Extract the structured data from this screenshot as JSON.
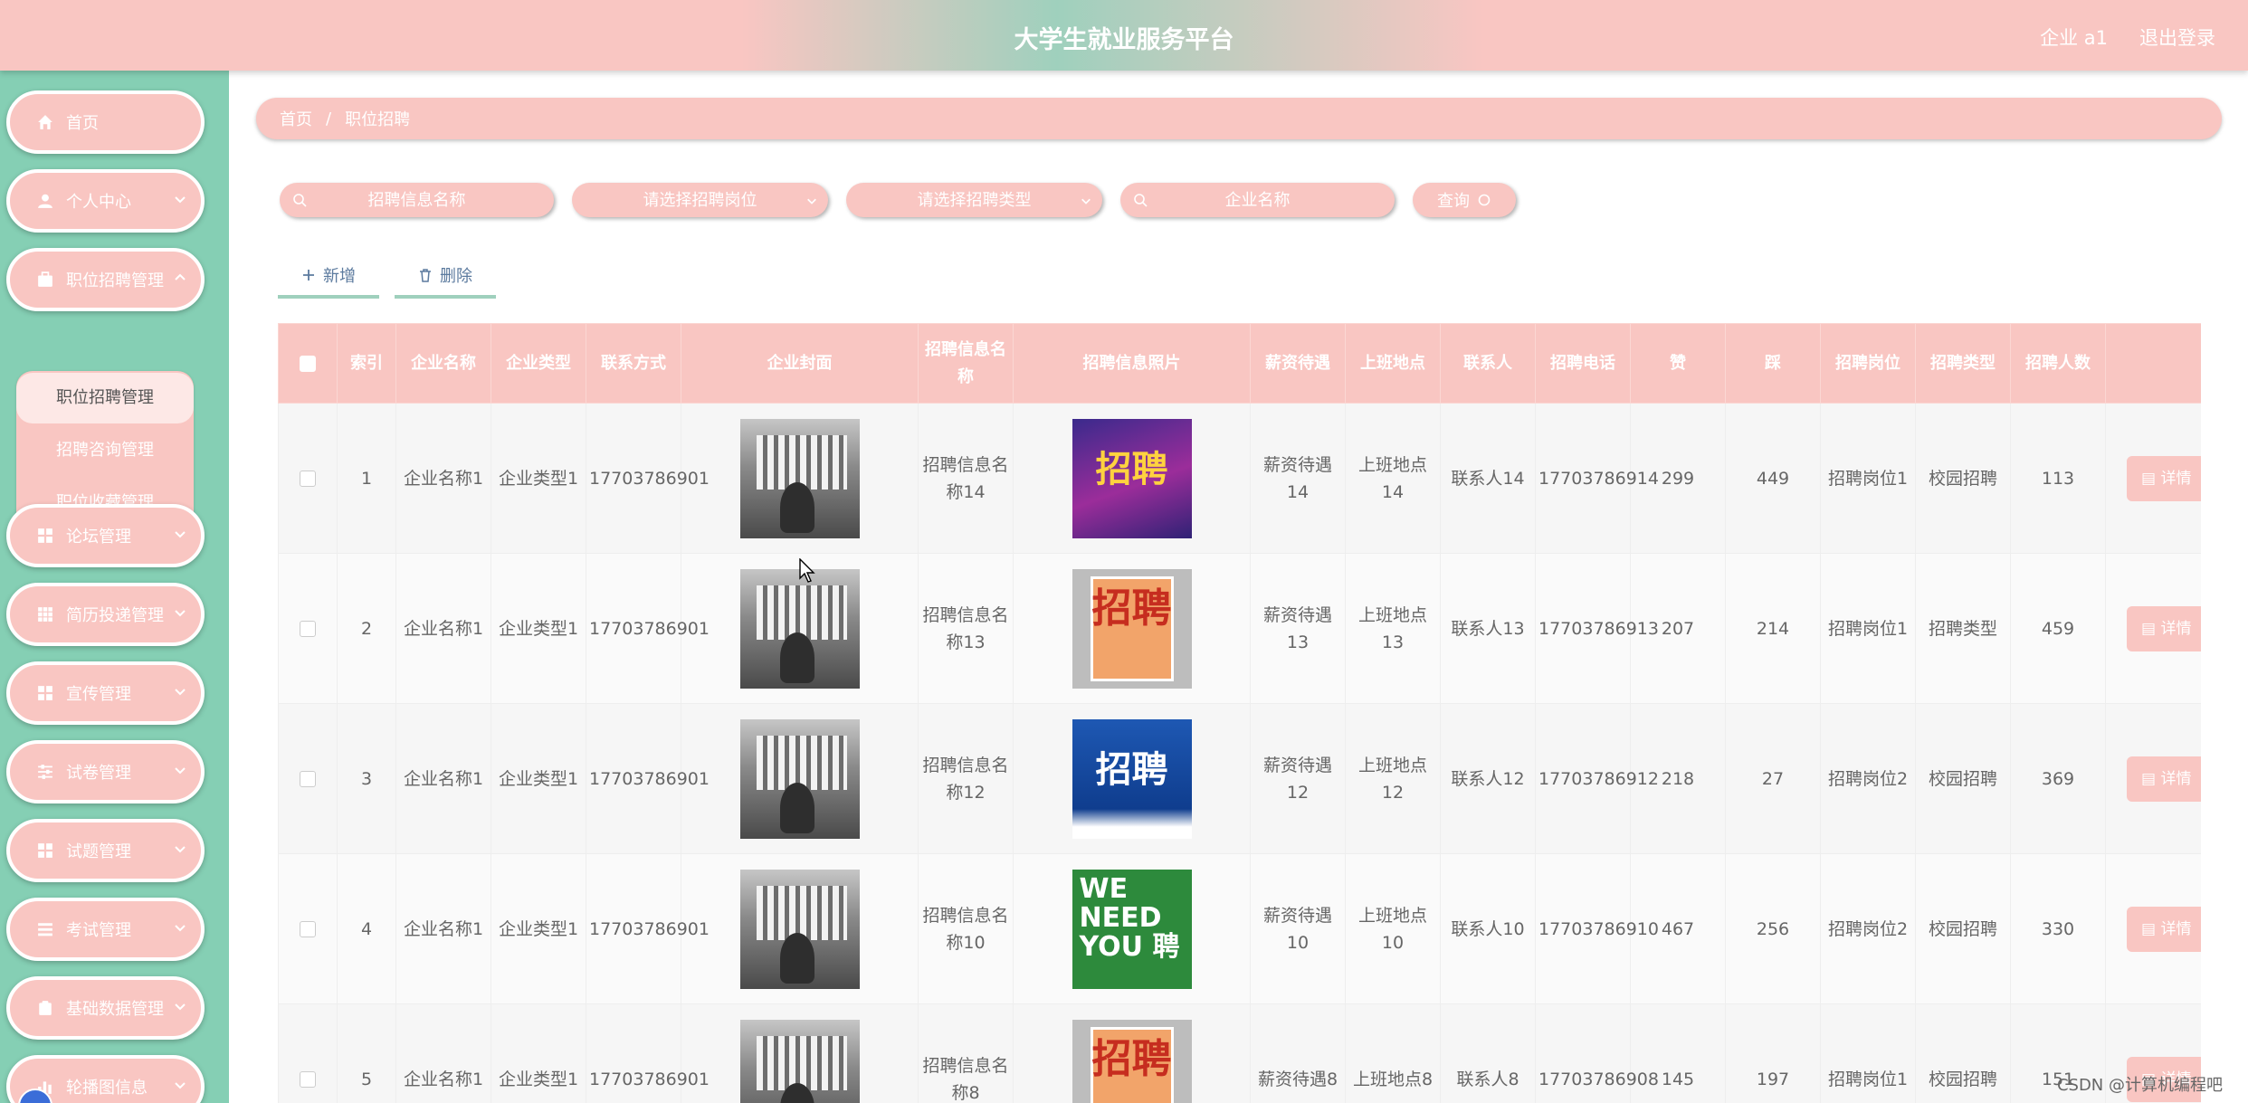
{
  "header": {
    "title": "大学生就业服务平台",
    "user": "企业 a1",
    "logout": "退出登录"
  },
  "sidebar": {
    "items": [
      {
        "label": "首页",
        "icon": "home-icon"
      },
      {
        "label": "个人中心",
        "icon": "user-icon"
      },
      {
        "label": "职位招聘管理",
        "icon": "briefcase-icon"
      },
      {
        "label": "论坛管理",
        "icon": "grid-icon"
      },
      {
        "label": "简历投递管理",
        "icon": "apps-icon"
      },
      {
        "label": "宣传管理",
        "icon": "grid-icon"
      },
      {
        "label": "试卷管理",
        "icon": "sliders-icon"
      },
      {
        "label": "试题管理",
        "icon": "grid-icon"
      },
      {
        "label": "考试管理",
        "icon": "menu-icon"
      },
      {
        "label": "基础数据管理",
        "icon": "clipboard-icon"
      },
      {
        "label": "轮播图信息",
        "icon": "chart-icon"
      }
    ],
    "submenu": [
      "职位招聘管理",
      "招聘咨询管理",
      "职位收藏管理"
    ]
  },
  "breadcrumb": {
    "home": "首页",
    "sep": "/",
    "current": "职位招聘"
  },
  "filters": {
    "name_placeholder": "招聘信息名称",
    "position_placeholder": "请选择招聘岗位",
    "type_placeholder": "请选择招聘类型",
    "company_placeholder": "企业名称",
    "query_label": "查询"
  },
  "actions": {
    "add": "新增",
    "delete": "删除"
  },
  "table": {
    "headers": [
      "索引",
      "企业名称",
      "企业类型",
      "联系方式",
      "企业封面",
      "招聘信息名称",
      "招聘信息照片",
      "薪资待遇",
      "上班地点",
      "联系人",
      "招聘电话",
      "赞",
      "踩",
      "招聘岗位",
      "招聘类型",
      "招聘人数"
    ],
    "detail_label": "详情",
    "rows": [
      {
        "idx": "1",
        "company": "企业名称1",
        "ctype": "企业类型1",
        "contact": "17703786901",
        "info": "招聘信息名称14",
        "photo": "招聘",
        "salary": "薪资待遇14",
        "place": "上班地点14",
        "person": "联系人14",
        "phone": "17703786914",
        "like": "299",
        "dislike": "449",
        "post": "招聘岗位1",
        "rtype": "校园招聘",
        "count": "113"
      },
      {
        "idx": "2",
        "company": "企业名称1",
        "ctype": "企业类型1",
        "contact": "17703786901",
        "info": "招聘信息名称13",
        "photo": "招聘",
        "salary": "薪资待遇13",
        "place": "上班地点13",
        "person": "联系人13",
        "phone": "17703786913",
        "like": "207",
        "dislike": "214",
        "post": "招聘岗位1",
        "rtype": "招聘类型",
        "count": "459"
      },
      {
        "idx": "3",
        "company": "企业名称1",
        "ctype": "企业类型1",
        "contact": "17703786901",
        "info": "招聘信息名称12",
        "photo": "招聘",
        "salary": "薪资待遇12",
        "place": "上班地点12",
        "person": "联系人12",
        "phone": "17703786912",
        "like": "218",
        "dislike": "27",
        "post": "招聘岗位2",
        "rtype": "校园招聘",
        "count": "369"
      },
      {
        "idx": "4",
        "company": "企业名称1",
        "ctype": "企业类型1",
        "contact": "17703786901",
        "info": "招聘信息名称10",
        "photo": "WE NEED YOU 聘",
        "salary": "薪资待遇10",
        "place": "上班地点10",
        "person": "联系人10",
        "phone": "17703786910",
        "like": "467",
        "dislike": "256",
        "post": "招聘岗位2",
        "rtype": "校园招聘",
        "count": "330"
      },
      {
        "idx": "5",
        "company": "企业名称1",
        "ctype": "企业类型1",
        "contact": "17703786901",
        "info": "招聘信息名称8",
        "photo": "招聘",
        "salary": "薪资待遇8",
        "place": "上班地点8",
        "person": "联系人8",
        "phone": "17703786908",
        "like": "145",
        "dislike": "197",
        "post": "招聘岗位1",
        "rtype": "校园招聘",
        "count": "151"
      }
    ]
  },
  "watermark": "CSDN @计算机编程吧",
  "colors": {
    "pink": "#f9c6c2",
    "mint": "#85cfb4",
    "accent": "#9fd0bd"
  }
}
